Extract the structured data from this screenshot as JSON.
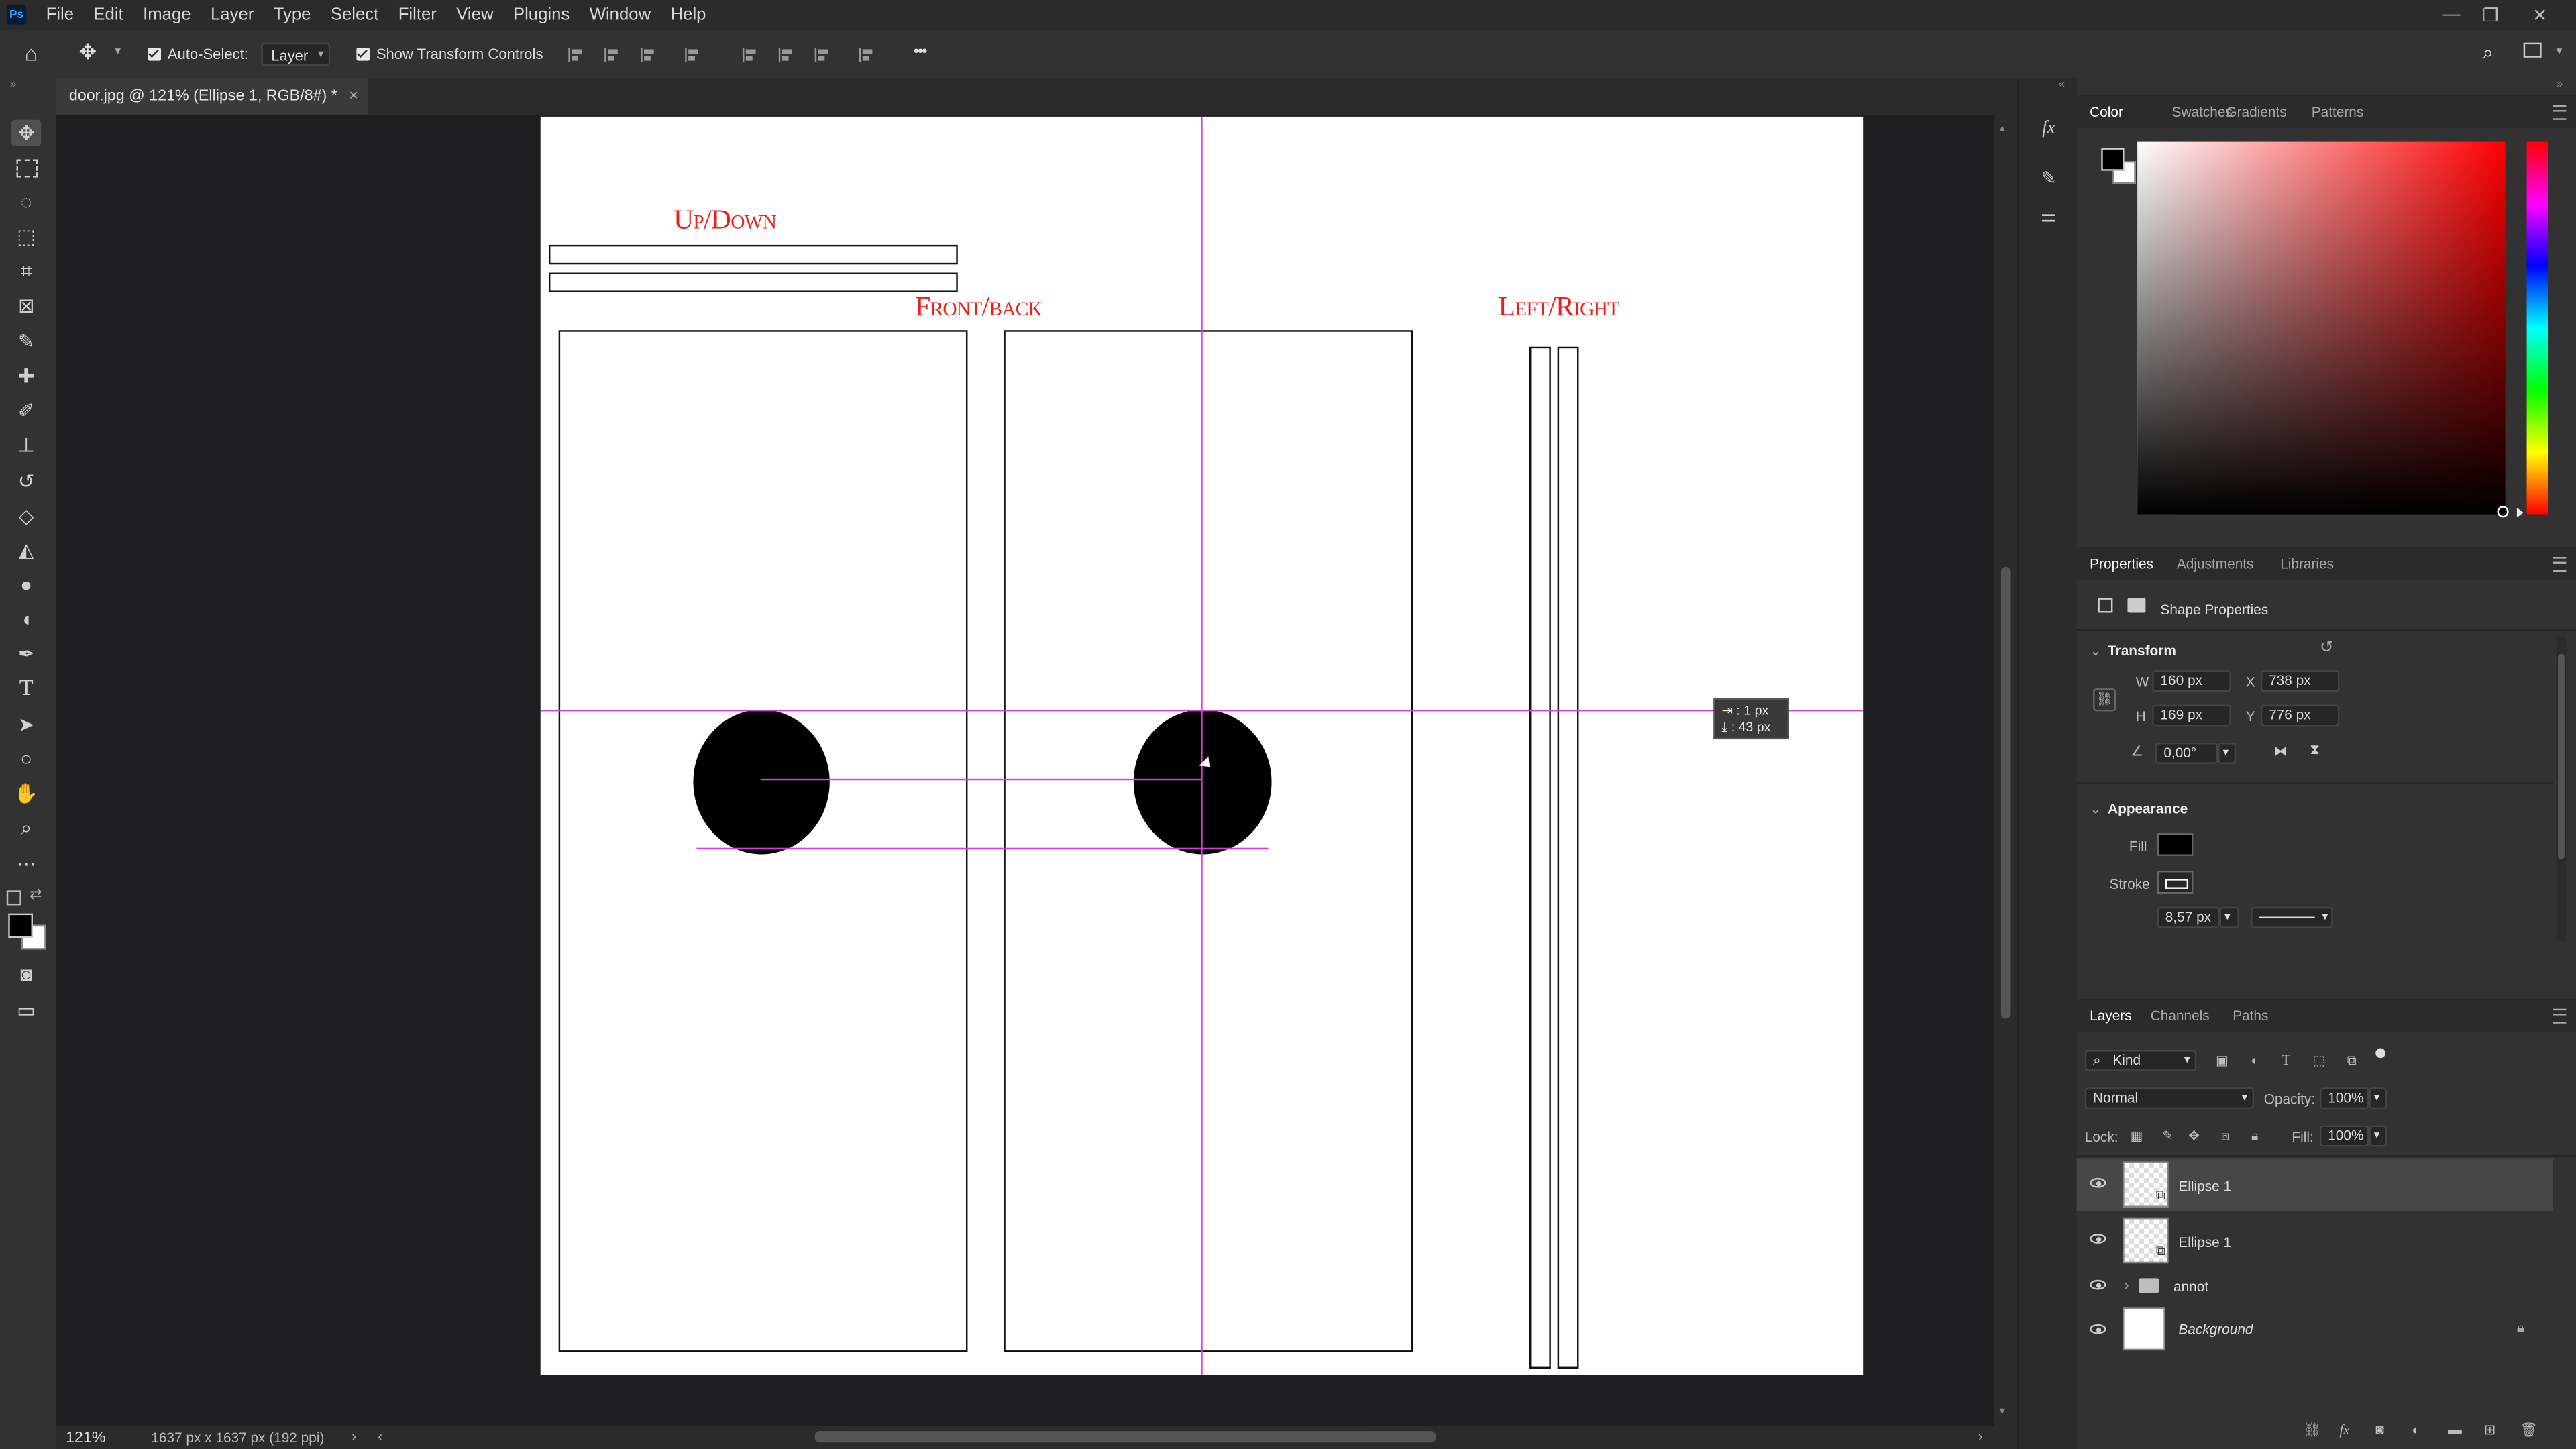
{
  "menu": {
    "app_icon": "Ps",
    "items": [
      "File",
      "Edit",
      "Image",
      "Layer",
      "Type",
      "Select",
      "Filter",
      "View",
      "Plugins",
      "Window",
      "Help"
    ]
  },
  "options": {
    "auto_select_label": "Auto-Select:",
    "auto_select_value": "Layer",
    "show_transform_label": "Show Transform Controls",
    "more": "•••"
  },
  "document": {
    "tab_title": "door.jpg @ 121% (Ellipse 1, RGB/8#) *",
    "labels": {
      "up_down": "Up/Down",
      "front_back": "Front/back",
      "left_right": "Left/Right"
    },
    "tooltip": {
      "line1": "⇥ :   1 px",
      "line2": "⤓ :  43 px"
    }
  },
  "status": {
    "zoom": "121%",
    "info": "1637 px x 1637 px (192 ppi)"
  },
  "color_panel": {
    "tabs": [
      "Color",
      "Swatches",
      "Gradients",
      "Patterns"
    ],
    "active": "Color",
    "foreground": "#000000",
    "background": "#ffffff",
    "hue": "#ff0000"
  },
  "properties_panel": {
    "tabs": [
      "Properties",
      "Adjustments",
      "Libraries"
    ],
    "active": "Properties",
    "subtitle": "Shape Properties",
    "transform_heading": "Transform",
    "w_label": "W",
    "w_value": "160 px",
    "h_label": "H",
    "h_value": "169 px",
    "x_label": "X",
    "x_value": "738 px",
    "y_label": "Y",
    "y_value": "776 px",
    "angle_value": "0,00°",
    "appearance_heading": "Appearance",
    "fill_label": "Fill",
    "fill_color": "#000000",
    "stroke_label": "Stroke",
    "stroke_width": "8,57 px"
  },
  "layers_panel": {
    "tabs": [
      "Layers",
      "Channels",
      "Paths"
    ],
    "active": "Layers",
    "filter_kind": "Kind",
    "blend_mode": "Normal",
    "opacity_label": "Opacity:",
    "opacity_value": "100%",
    "lock_label": "Lock:",
    "fill_label": "Fill:",
    "fill_value": "100%",
    "layers": [
      {
        "name": "Ellipse 1",
        "selected": true
      },
      {
        "name": "Ellipse 1",
        "selected": false
      },
      {
        "name": "annot",
        "selected": false
      },
      {
        "name": "Background",
        "selected": false
      }
    ]
  }
}
